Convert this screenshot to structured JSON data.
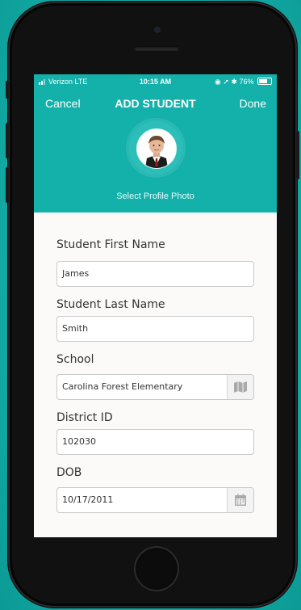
{
  "status_bar": {
    "carrier": "Verizon  LTE",
    "time": "10:15 AM",
    "battery": "76%"
  },
  "nav": {
    "cancel_label": "Cancel",
    "title": "ADD STUDENT",
    "done_label": "Done"
  },
  "profile": {
    "select_photo_label": "Select Profile Photo"
  },
  "form": {
    "first_name": {
      "label": "Student First Name",
      "value": "James"
    },
    "last_name": {
      "label": "Student Last Name",
      "value": "Smith"
    },
    "school": {
      "label": "School",
      "value": "Carolina Forest Elementary",
      "button_icon": "map-icon"
    },
    "district_id": {
      "label": "District ID",
      "value": "102030"
    },
    "dob": {
      "label": "DOB",
      "value": "10/17/2011",
      "button_icon": "calendar-icon"
    }
  },
  "colors": {
    "accent": "#14b0aa",
    "background": "#14b1ab",
    "phone_body": "#111111",
    "form_bg": "#fbfaf8"
  }
}
